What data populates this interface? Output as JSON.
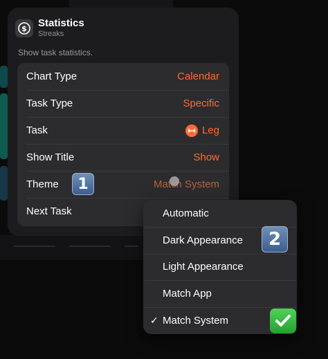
{
  "widget": {
    "title": "Statistics",
    "subtitle": "Streaks",
    "description": "Show task statistics."
  },
  "settings": [
    {
      "label": "Chart Type",
      "value": "Calendar"
    },
    {
      "label": "Task Type",
      "value": "Specific"
    },
    {
      "label": "Task",
      "value": "Leg"
    },
    {
      "label": "Show Title",
      "value": "Show"
    },
    {
      "label": "Theme",
      "value": "Match System"
    },
    {
      "label": "Next Task",
      "value": ""
    }
  ],
  "menu": {
    "items": [
      "Automatic",
      "Dark Appearance",
      "Light Appearance",
      "Match App",
      "Match System"
    ],
    "selected": "Match System"
  },
  "annotations": {
    "step1": "1",
    "step2": "2"
  },
  "colors": {
    "accent": "#ff6b35",
    "card_bg": "#1c1c1e",
    "group_bg": "#2c2c2e",
    "check_green": "#34c759"
  },
  "icons": {
    "app": "streaks-dollar-icon",
    "task": "dumbbell-icon",
    "selected": "checkmark-icon",
    "done": "green-checkmark-icon"
  }
}
